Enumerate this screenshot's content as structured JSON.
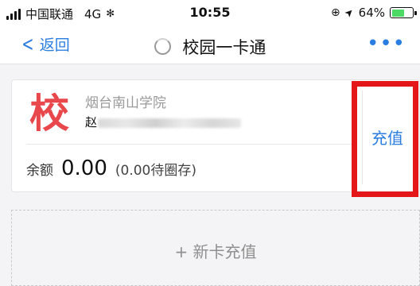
{
  "status_bar": {
    "carrier": "中国联通",
    "network": "4G",
    "activity_glyph": "✻",
    "time": "10:55",
    "lock_rotation_glyph": "⊕",
    "location_glyph": "➤",
    "battery": "64%",
    "battery_level": 0.64
  },
  "nav": {
    "back_label": "返回",
    "title": "校园一卡通",
    "more_glyph": "•••"
  },
  "card": {
    "logo_char": "校",
    "school_name": "烟台南山学院",
    "holder_visible_char": "赵",
    "balance_label": "余额",
    "balance_amount": "0.00",
    "pending": "(0.00待圈存)",
    "recharge_label": "充值"
  },
  "new_card": {
    "label": "+ 新卡充值"
  },
  "colors": {
    "accent": "#2a7de1",
    "logo": "#e8474c",
    "highlight_box": "#e3161a",
    "battery_fill": "#4cd964"
  }
}
